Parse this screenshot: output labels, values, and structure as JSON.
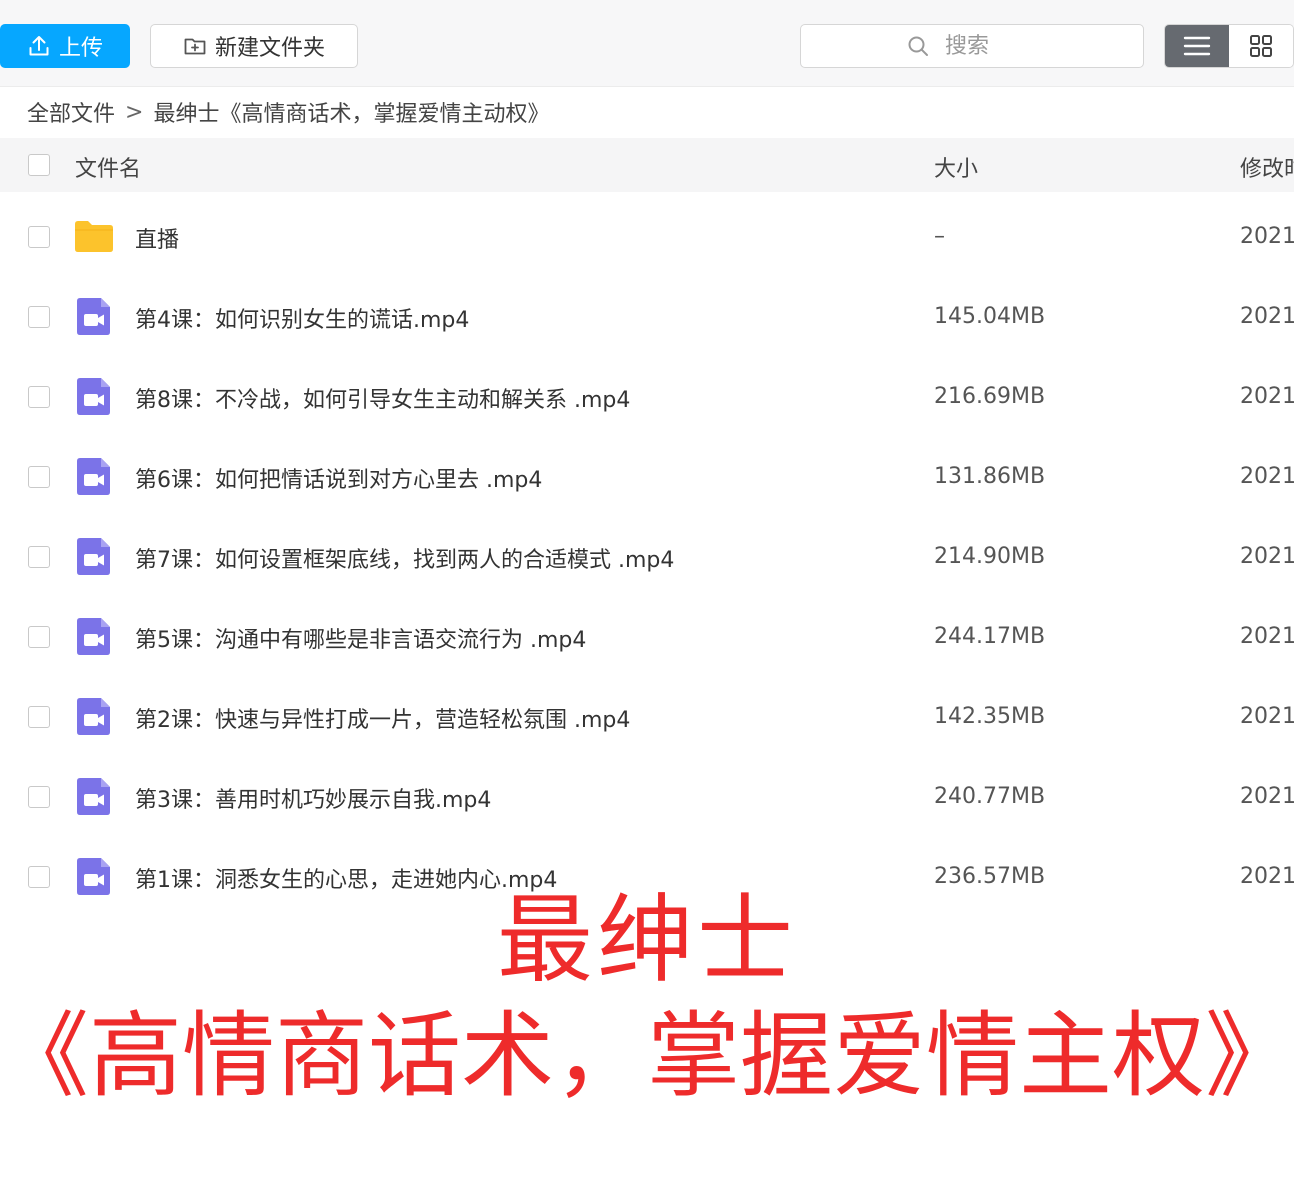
{
  "toolbar": {
    "upload_label": "上传",
    "new_folder_label": "新建文件夹",
    "search_placeholder": "搜索",
    "accent_color": "#06a7ff"
  },
  "breadcrumb": {
    "root": "全部文件",
    "separator": ">",
    "current": "最绅士《高情商话术，掌握爱情主动权》"
  },
  "table": {
    "col_name": "文件名",
    "col_size": "大小",
    "col_date": "修改时间",
    "rows": [
      {
        "type": "folder",
        "icon": "folder-icon",
        "name": "直播",
        "size": "–",
        "date": "2021"
      },
      {
        "type": "video",
        "icon": "video-file-icon",
        "name": "第4课：如何识别女生的谎话.mp4",
        "size": "145.04MB",
        "date": "2021"
      },
      {
        "type": "video",
        "icon": "video-file-icon",
        "name": "第8课：不冷战，如何引导女生主动和解关系 .mp4",
        "size": "216.69MB",
        "date": "2021"
      },
      {
        "type": "video",
        "icon": "video-file-icon",
        "name": "第6课：如何把情话说到对方心里去 .mp4",
        "size": "131.86MB",
        "date": "2021"
      },
      {
        "type": "video",
        "icon": "video-file-icon",
        "name": "第7课：如何设置框架底线，找到两人的合适模式 .mp4",
        "size": "214.90MB",
        "date": "2021"
      },
      {
        "type": "video",
        "icon": "video-file-icon",
        "name": "第5课：沟通中有哪些是非言语交流行为 .mp4",
        "size": "244.17MB",
        "date": "2021"
      },
      {
        "type": "video",
        "icon": "video-file-icon",
        "name": "第2课：快速与异性打成一片，营造轻松氛围 .mp4",
        "size": "142.35MB",
        "date": "2021"
      },
      {
        "type": "video",
        "icon": "video-file-icon",
        "name": "第3课：善用时机巧妙展示自我.mp4",
        "size": "240.77MB",
        "date": "2021"
      },
      {
        "type": "video",
        "icon": "video-file-icon",
        "name": "第1课：洞悉女生的心思，走进她内心.mp4",
        "size": "236.57MB",
        "date": "2021"
      }
    ]
  },
  "overlay": {
    "line1": "最绅士",
    "line2": "《高情商话术，掌握爱情主权》",
    "color": "#ee2b2b"
  },
  "colors": {
    "folder": "#fcc32c",
    "video_icon": "#7b73e8"
  }
}
